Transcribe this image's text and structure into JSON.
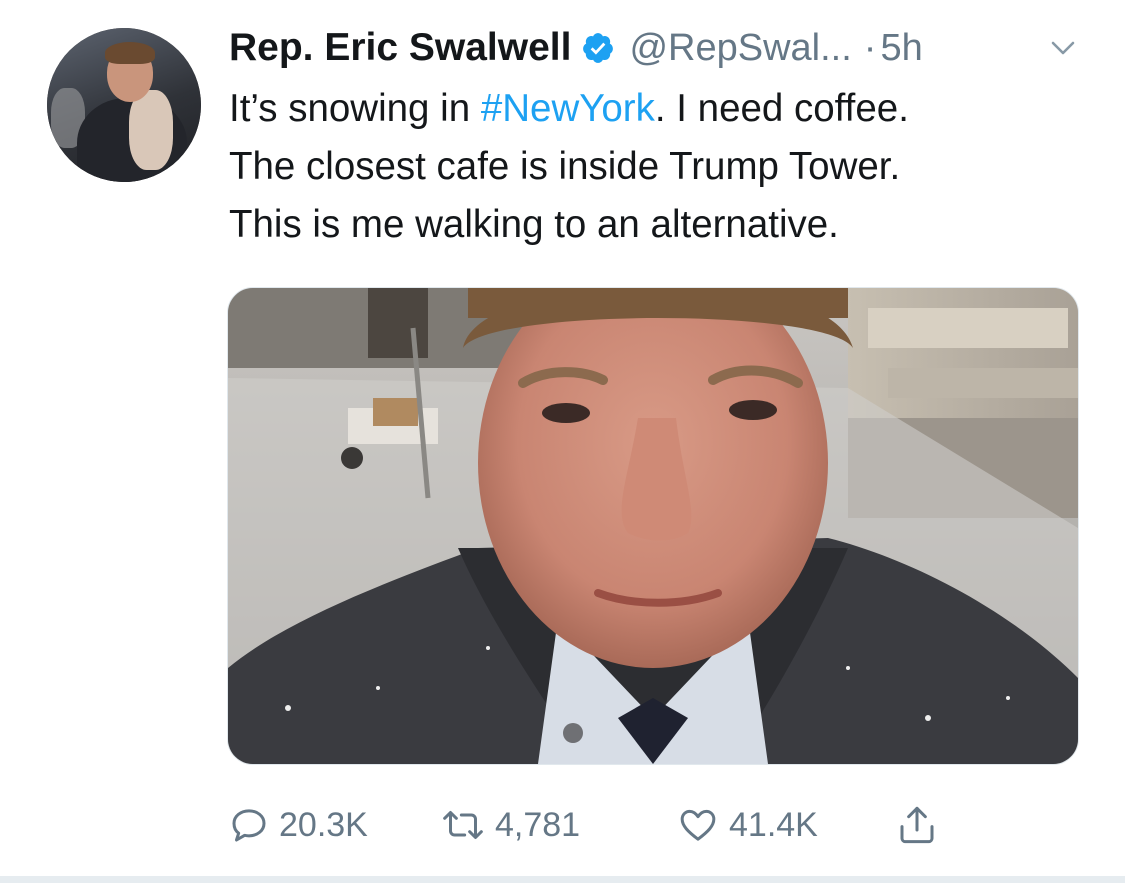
{
  "tweet": {
    "author_name": "Rep. Eric Swalwell",
    "handle": "@RepSwal...",
    "separator": "·",
    "time": "5h",
    "text_parts": {
      "line1_before": "It’s snowing in ",
      "hashtag": "#NewYork",
      "line1_after": ". I need coffee.",
      "line2": "The closest cafe is inside Trump Tower.",
      "line3": "This is me walking to an alternative."
    },
    "stats": {
      "replies": "20.3K",
      "retweets": "4,781",
      "likes": "41.4K"
    }
  },
  "icons": {
    "verified": "verified-badge-icon",
    "caret": "chevron-down-icon",
    "reply": "reply-icon",
    "retweet": "retweet-icon",
    "like": "heart-icon",
    "share": "share-icon"
  },
  "colors": {
    "link": "#1da1f2",
    "secondary_text": "#657786",
    "primary_text": "#14171a"
  }
}
